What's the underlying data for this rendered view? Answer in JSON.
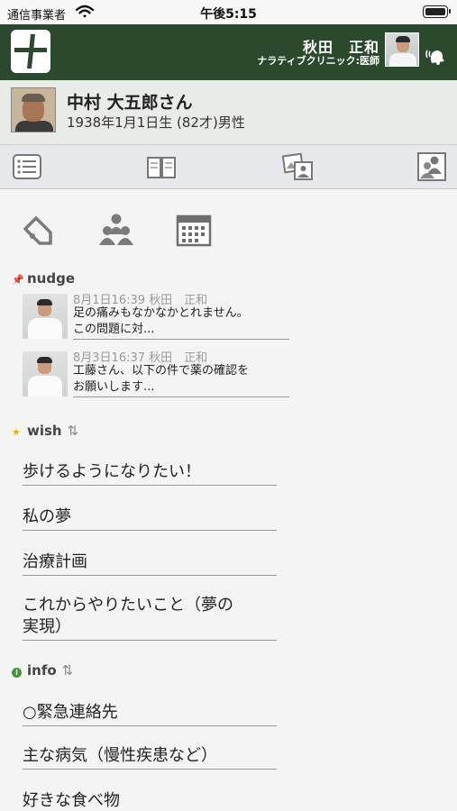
{
  "status_bar": {
    "carrier": "通信事業者",
    "time": "午後5:15"
  },
  "header": {
    "doctor_name": "秋田　正和",
    "clinic": "ナラティブクリニック:医師"
  },
  "patient": {
    "name": "中村 大五郎さん",
    "info": "1938年1月1日生 (82才)男性"
  },
  "tabs": [
    {
      "icon": "list-icon"
    },
    {
      "icon": "book-icon"
    },
    {
      "icon": "photo-person-icon"
    },
    {
      "icon": "people-icon"
    }
  ],
  "tools": [
    {
      "icon": "tag-icon"
    },
    {
      "icon": "group-icon"
    },
    {
      "icon": "calendar-icon"
    }
  ],
  "nudge": {
    "title": "nudge",
    "messages": [
      {
        "meta": "8月1日16:39 秋田　正和",
        "line1": "足の痛みもなかなかとれません。",
        "line2": "この問題に対..."
      },
      {
        "meta": "8月3日16:37 秋田　正和",
        "line1": "工藤さん、以下の件で薬の確認を",
        "line2": "お願いします..."
      }
    ]
  },
  "wish": {
    "title": "wish",
    "items": [
      "歩けるようになりたい！",
      "私の夢",
      "治療計画",
      "これからやりたいこと（夢の",
      "実現）"
    ]
  },
  "info": {
    "title": "info",
    "items": [
      "○緊急連絡先",
      "主な病気（慢性疾患など）",
      "好きな食べ物"
    ]
  },
  "colors": {
    "header_bg": "#2b4a2d",
    "wish_star": "#e8b400",
    "info_dot": "#3c9a32",
    "pin": "#b3262a"
  }
}
